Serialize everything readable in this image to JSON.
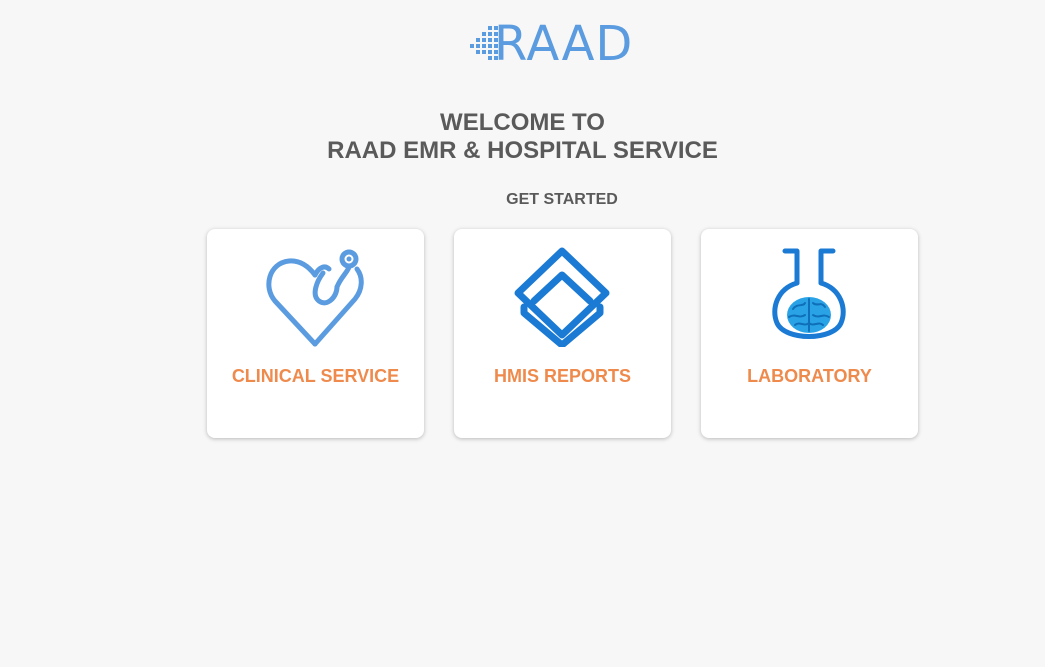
{
  "brand": {
    "name": "RAAD",
    "color": "#5b9be0"
  },
  "header": {
    "welcome_line1": "WELCOME TO",
    "welcome_line2": "RAAD EMR & HOSPITAL SERVICE",
    "get_started": "GET STARTED"
  },
  "colors": {
    "text": "#5a5a5a",
    "card_label": "#ef8a4d",
    "icon_blue": "#1a7ad4",
    "background": "#f7f7f7"
  },
  "cards": [
    {
      "label": "CLINICAL SERVICE",
      "icon": "stethoscope-heart-icon"
    },
    {
      "label": "HMIS REPORTS",
      "icon": "layers-icon"
    },
    {
      "label": "LABORATORY",
      "icon": "flask-brain-icon"
    }
  ]
}
